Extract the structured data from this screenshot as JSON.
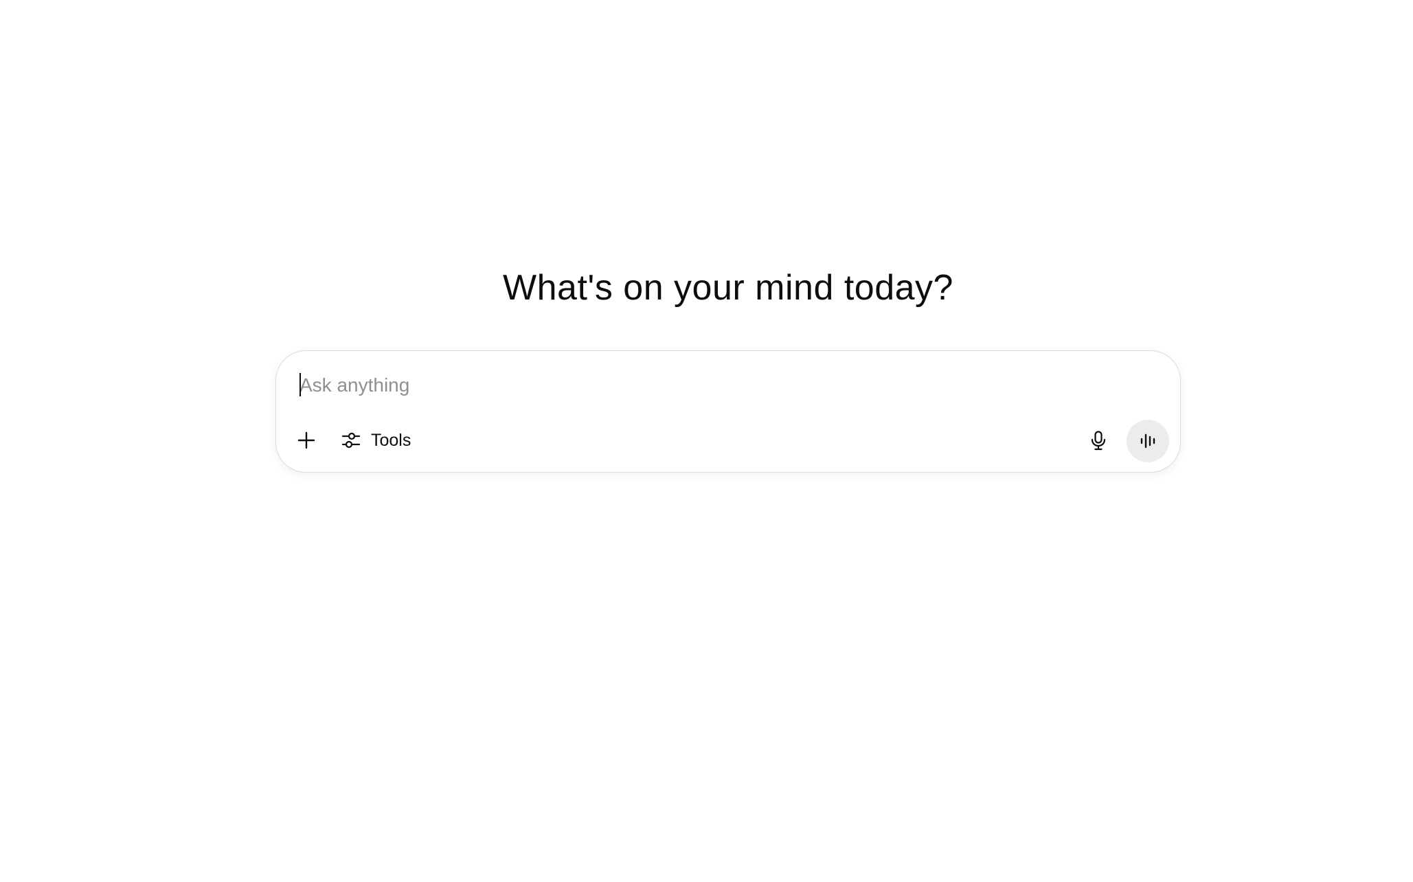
{
  "main": {
    "heading": "What's on your mind today?"
  },
  "composer": {
    "placeholder": "Ask anything",
    "tools_label": "Tools",
    "icons": {
      "add": "plus-icon",
      "tools": "sliders-icon",
      "dictate": "microphone-icon",
      "voice": "voice-waveform-icon"
    }
  },
  "colors": {
    "text": "#0d0d0d",
    "placeholder": "#8f8f8f",
    "border": "#dcdcdc",
    "voice_button_bg": "#ececec"
  }
}
